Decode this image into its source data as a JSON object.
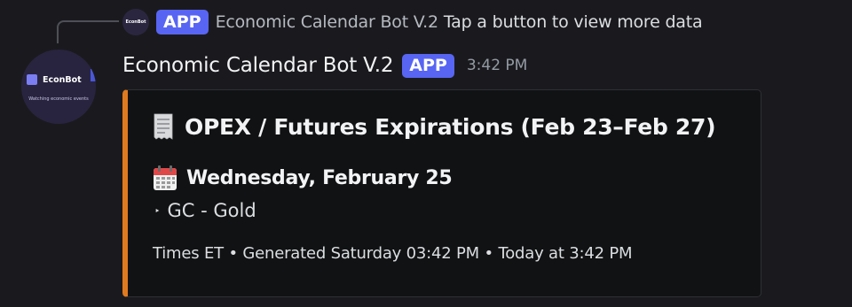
{
  "reply": {
    "avatar_text": "EconBot",
    "badge": "APP",
    "author": "Economic Calendar Bot V.2",
    "text": "Tap a button to view more data"
  },
  "avatar": {
    "logo_text": "EconBot",
    "tagline": "Watching economic events"
  },
  "message": {
    "author": "Economic Calendar Bot V.2",
    "badge": "APP",
    "timestamp": "3:42 PM"
  },
  "embed": {
    "accent_color": "#e07a1e",
    "title_icon": "receipt-icon",
    "title": "OPEX / Futures Expirations (Feb 23–Feb 27)",
    "date_icon": "calendar-icon",
    "date": "Wednesday, February 25",
    "item_marker": "‣",
    "item": "GC - Gold",
    "footer": "Times ET • Generated Saturday 03:42 PM • Today at 3:42 PM"
  },
  "colors": {
    "background": "#1a1a1e",
    "badge": "#5865f2",
    "embed_background": "#111214"
  }
}
